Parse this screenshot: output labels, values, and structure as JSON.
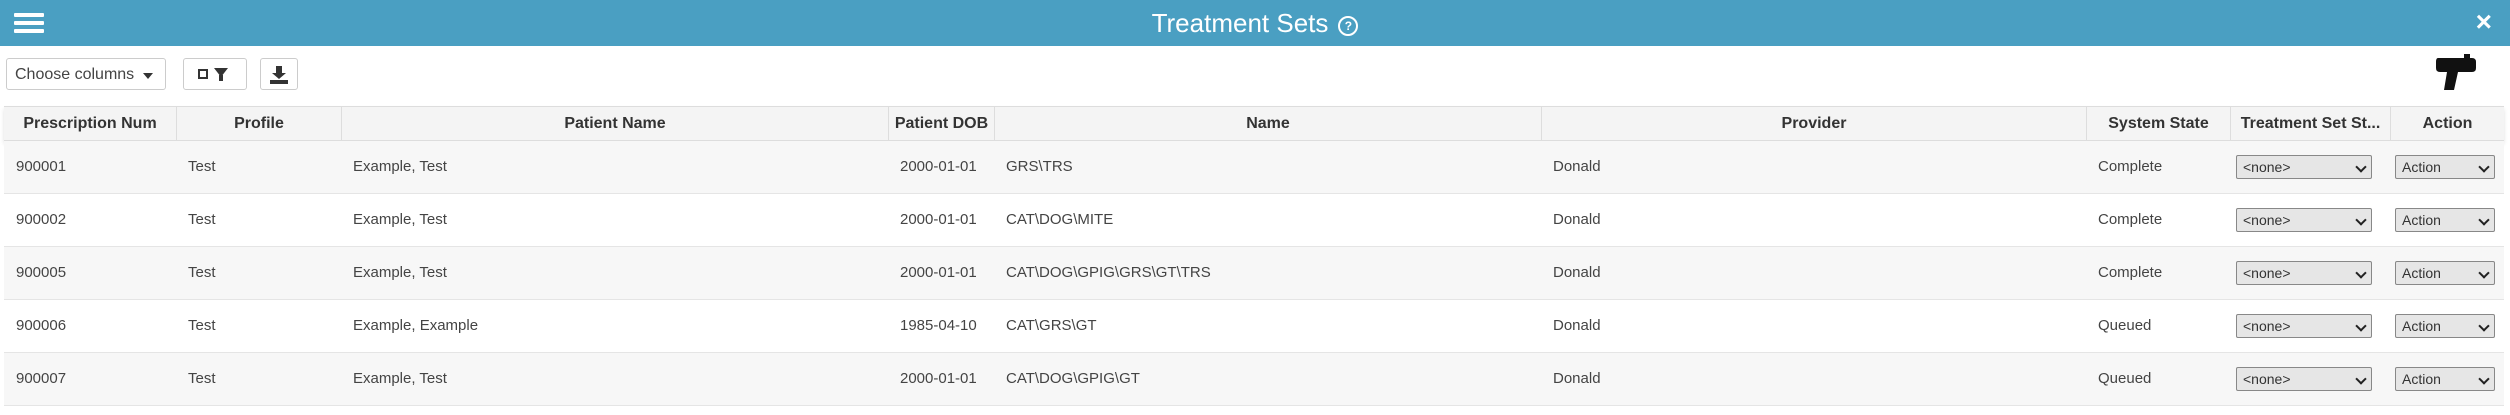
{
  "header": {
    "title": "Treatment Sets",
    "help_glyph": "?",
    "close_glyph": "×"
  },
  "toolbar": {
    "choose_columns_label": "Choose columns"
  },
  "table": {
    "columns": [
      "Prescription Num",
      "Profile",
      "Patient Name",
      "Patient DOB",
      "Name",
      "Provider",
      "System State",
      "Treatment Set St...",
      "Action"
    ],
    "rows": [
      {
        "prescription_num": "900001",
        "profile": "Test",
        "patient_name": "Example, Test",
        "patient_dob": "2000-01-01",
        "name": "GRS\\TRS",
        "provider": "Donald",
        "system_state": "Complete",
        "treatment_set_state": "<none>",
        "action": "Action"
      },
      {
        "prescription_num": "900002",
        "profile": "Test",
        "patient_name": "Example, Test",
        "patient_dob": "2000-01-01",
        "name": "CAT\\DOG\\MITE",
        "provider": "Donald",
        "system_state": "Complete",
        "treatment_set_state": "<none>",
        "action": "Action"
      },
      {
        "prescription_num": "900005",
        "profile": "Test",
        "patient_name": "Example, Test",
        "patient_dob": "2000-01-01",
        "name": "CAT\\DOG\\GPIG\\GRS\\GT\\TRS",
        "provider": "Donald",
        "system_state": "Complete",
        "treatment_set_state": "<none>",
        "action": "Action"
      },
      {
        "prescription_num": "900006",
        "profile": "Test",
        "patient_name": "Example, Example",
        "patient_dob": "1985-04-10",
        "name": "CAT\\GRS\\GT",
        "provider": "Donald",
        "system_state": "Queued",
        "treatment_set_state": "<none>",
        "action": "Action"
      },
      {
        "prescription_num": "900007",
        "profile": "Test",
        "patient_name": "Example, Test",
        "patient_dob": "2000-01-01",
        "name": "CAT\\DOG\\GPIG\\GT",
        "provider": "Donald",
        "system_state": "Queued",
        "treatment_set_state": "<none>",
        "action": "Action"
      }
    ]
  },
  "colors": {
    "header_bg": "#4a9fc2",
    "header_text": "#ffffff",
    "row_alt_bg": "#f7f7f7"
  },
  "icons": {
    "menu": "hamburger-icon",
    "help": "help-circle-icon",
    "close": "close-icon",
    "filter": "filter-icon",
    "download": "download-icon",
    "scanner": "barcode-scanner-icon"
  }
}
